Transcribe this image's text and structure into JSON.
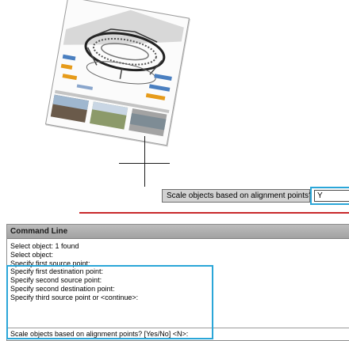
{
  "canvas": {
    "image_icon": "stadium-illustration"
  },
  "prompt": {
    "label": "Scale objects based on alignment points?",
    "value": "Y"
  },
  "command_line": {
    "title": "Command Line",
    "history": [
      "Select object: 1 found",
      "Select object:",
      "Specify first source point:",
      "Specify first destination point:",
      "Specify second source point:",
      "Specify second destination point:",
      "Specify third source point or <continue>:"
    ],
    "current_prompt": "Scale objects based on alignment points? [Yes/No] <N>:"
  },
  "colors": {
    "highlight": "#2aa6d8",
    "rule": "#c8282b",
    "title_bar": "#b0b0b0"
  }
}
